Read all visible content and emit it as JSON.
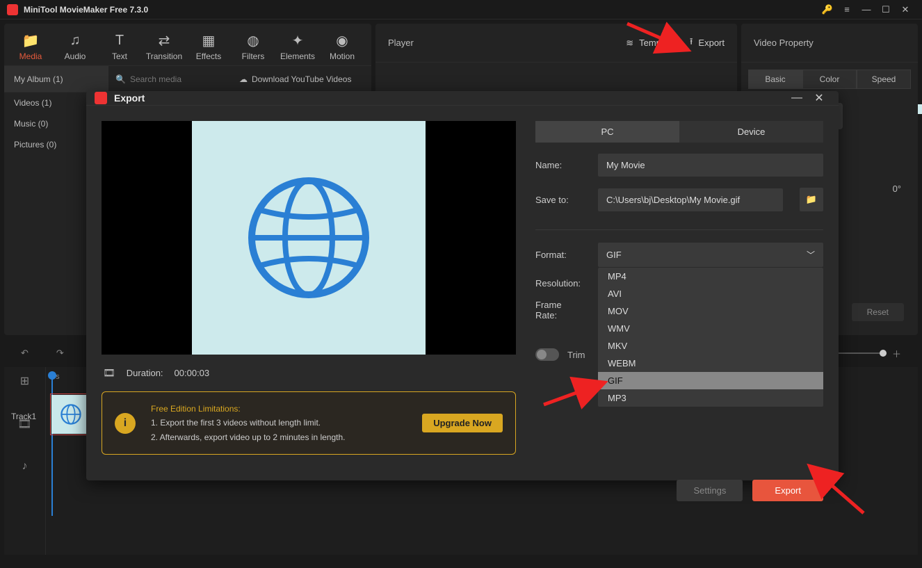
{
  "titlebar": {
    "title": "MiniTool MovieMaker Free 7.3.0"
  },
  "toolbar": {
    "media": "Media",
    "audio": "Audio",
    "text": "Text",
    "transition": "Transition",
    "effects": "Effects",
    "filters": "Filters",
    "elements": "Elements",
    "motion": "Motion"
  },
  "mediaRow": {
    "album": "My Album (1)",
    "searchPlaceholder": "Search media",
    "download": "Download YouTube Videos"
  },
  "mediaList": {
    "videos": "Videos (1)",
    "music": "Music (0)",
    "pictures": "Pictures (0)"
  },
  "player": {
    "label": "Player",
    "template": "Template",
    "export": "Export"
  },
  "prop": {
    "title": "Video Property",
    "tabs": {
      "basic": "Basic",
      "color": "Color",
      "speed": "Speed"
    },
    "rotation": "0°",
    "reset": "Reset"
  },
  "timeline": {
    "time": "0s",
    "track": "Track1"
  },
  "dialog": {
    "title": "Export",
    "tabs": {
      "pc": "PC",
      "device": "Device"
    },
    "nameLabel": "Name:",
    "nameValue": "My Movie",
    "saveLabel": "Save to:",
    "saveValue": "C:\\Users\\bj\\Desktop\\My Movie.gif",
    "formatLabel": "Format:",
    "formatValue": "GIF",
    "formatOptions": [
      "MP4",
      "AVI",
      "MOV",
      "WMV",
      "MKV",
      "WEBM",
      "GIF",
      "MP3"
    ],
    "resLabel": "Resolution:",
    "frLabel": "Frame Rate:",
    "trim": "Trim",
    "durLabel": "Duration:",
    "durValue": "00:00:03",
    "info": {
      "title": "Free Edition Limitations:",
      "l1": "1. Export the first 3 videos without length limit.",
      "l2": "2. Afterwards, export video up to 2 minutes in length.",
      "upgrade": "Upgrade Now"
    },
    "settings": "Settings",
    "export": "Export"
  }
}
